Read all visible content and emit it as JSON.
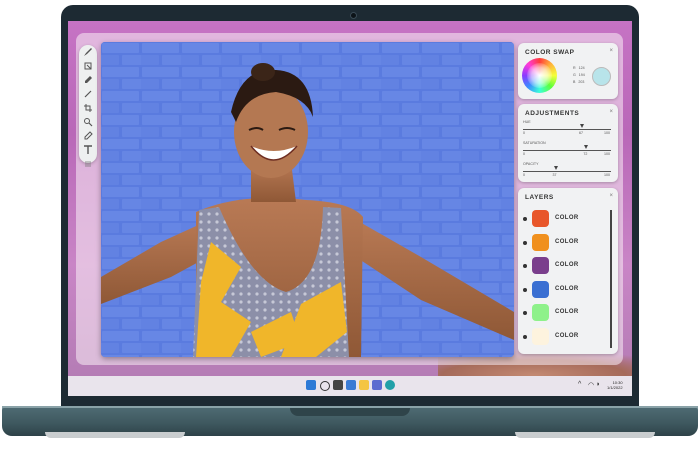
{
  "color_swap": {
    "title": "COLOR SWAP",
    "close": "×",
    "rgb": [
      {
        "key": "R",
        "value": "124"
      },
      {
        "key": "G",
        "value": "194"
      },
      {
        "key": "B",
        "value": "203"
      }
    ],
    "swatch_color": "#b8e4ea"
  },
  "adjustments": {
    "title": "ADJUSTMENTS",
    "close": "×",
    "sliders": [
      {
        "label": "HUE",
        "min": "0",
        "value": "67",
        "max": "100",
        "level": 0.67
      },
      {
        "label": "SATURATION",
        "min": "0",
        "value": "72",
        "max": "100",
        "level": 0.72
      },
      {
        "label": "OPACITY",
        "min": "0",
        "value": "37",
        "max": "100",
        "level": 0.37
      }
    ]
  },
  "layers": {
    "title": "LAYERS",
    "close": "×",
    "items": [
      {
        "label": "COLOR",
        "color": "#e8562a"
      },
      {
        "label": "COLOR",
        "color": "#f0901e"
      },
      {
        "label": "COLOR",
        "color": "#7a3e8c"
      },
      {
        "label": "COLOR",
        "color": "#3a6fd2"
      },
      {
        "label": "COLOR",
        "color": "#8ef18a"
      },
      {
        "label": "COLOR",
        "color": "#fdf3de"
      }
    ]
  },
  "tools": [
    "brush-icon",
    "layers-icon",
    "pen-icon",
    "line-icon",
    "crop-icon",
    "zoom-icon",
    "eyedropper-icon",
    "text-icon",
    "settings-icon"
  ],
  "taskbar": {
    "clock_time": "10:30",
    "clock_date": "1/1/2022",
    "apps": [
      "windows-start-icon",
      "search-icon",
      "task-view-icon",
      "widgets-icon",
      "explorer-icon",
      "store-icon",
      "edge-icon"
    ]
  }
}
